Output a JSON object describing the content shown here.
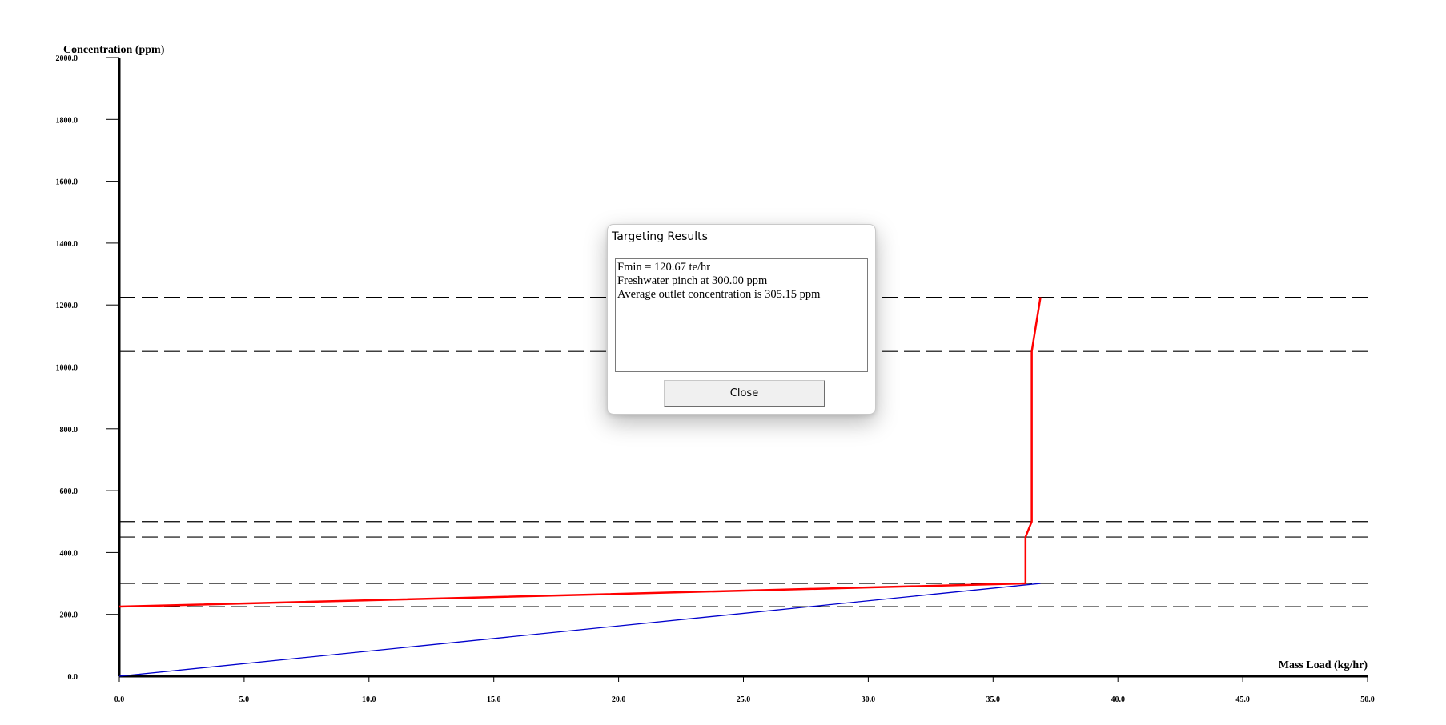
{
  "chart_data": {
    "type": "line",
    "title": "",
    "xlabel": "Mass Load (kg/hr)",
    "ylabel": "Concentration (ppm)",
    "xlim": [
      0,
      50
    ],
    "ylim": [
      0,
      2000
    ],
    "x_ticks": [
      "0.0",
      "5.0",
      "10.0",
      "15.0",
      "20.0",
      "25.0",
      "30.0",
      "35.0",
      "40.0",
      "45.0",
      "50.0"
    ],
    "y_ticks": [
      "0.0",
      "200.0",
      "400.0",
      "600.0",
      "800.0",
      "1000.0",
      "1200.0",
      "1400.0",
      "1600.0",
      "1800.0",
      "2000.0"
    ],
    "grid": false,
    "reference_lines_y": [
      225,
      300,
      450,
      500,
      1050,
      1225
    ],
    "series": [
      {
        "color": "#ff0000",
        "points": [
          [
            0,
            225
          ],
          [
            36.3,
            300
          ],
          [
            36.3,
            450
          ],
          [
            36.55,
            500
          ],
          [
            36.55,
            1050
          ],
          [
            36.9,
            1225
          ]
        ]
      },
      {
        "color": "#0000cc",
        "points": [
          [
            0,
            0
          ],
          [
            36.9,
            300
          ]
        ]
      }
    ]
  },
  "dialog": {
    "title": "Targeting Results",
    "lines": [
      "Fmin = 120.67 te/hr",
      "Freshwater pinch at 300.00 ppm",
      "Average outlet concentration is 305.15 ppm"
    ],
    "close_label": "Close"
  }
}
